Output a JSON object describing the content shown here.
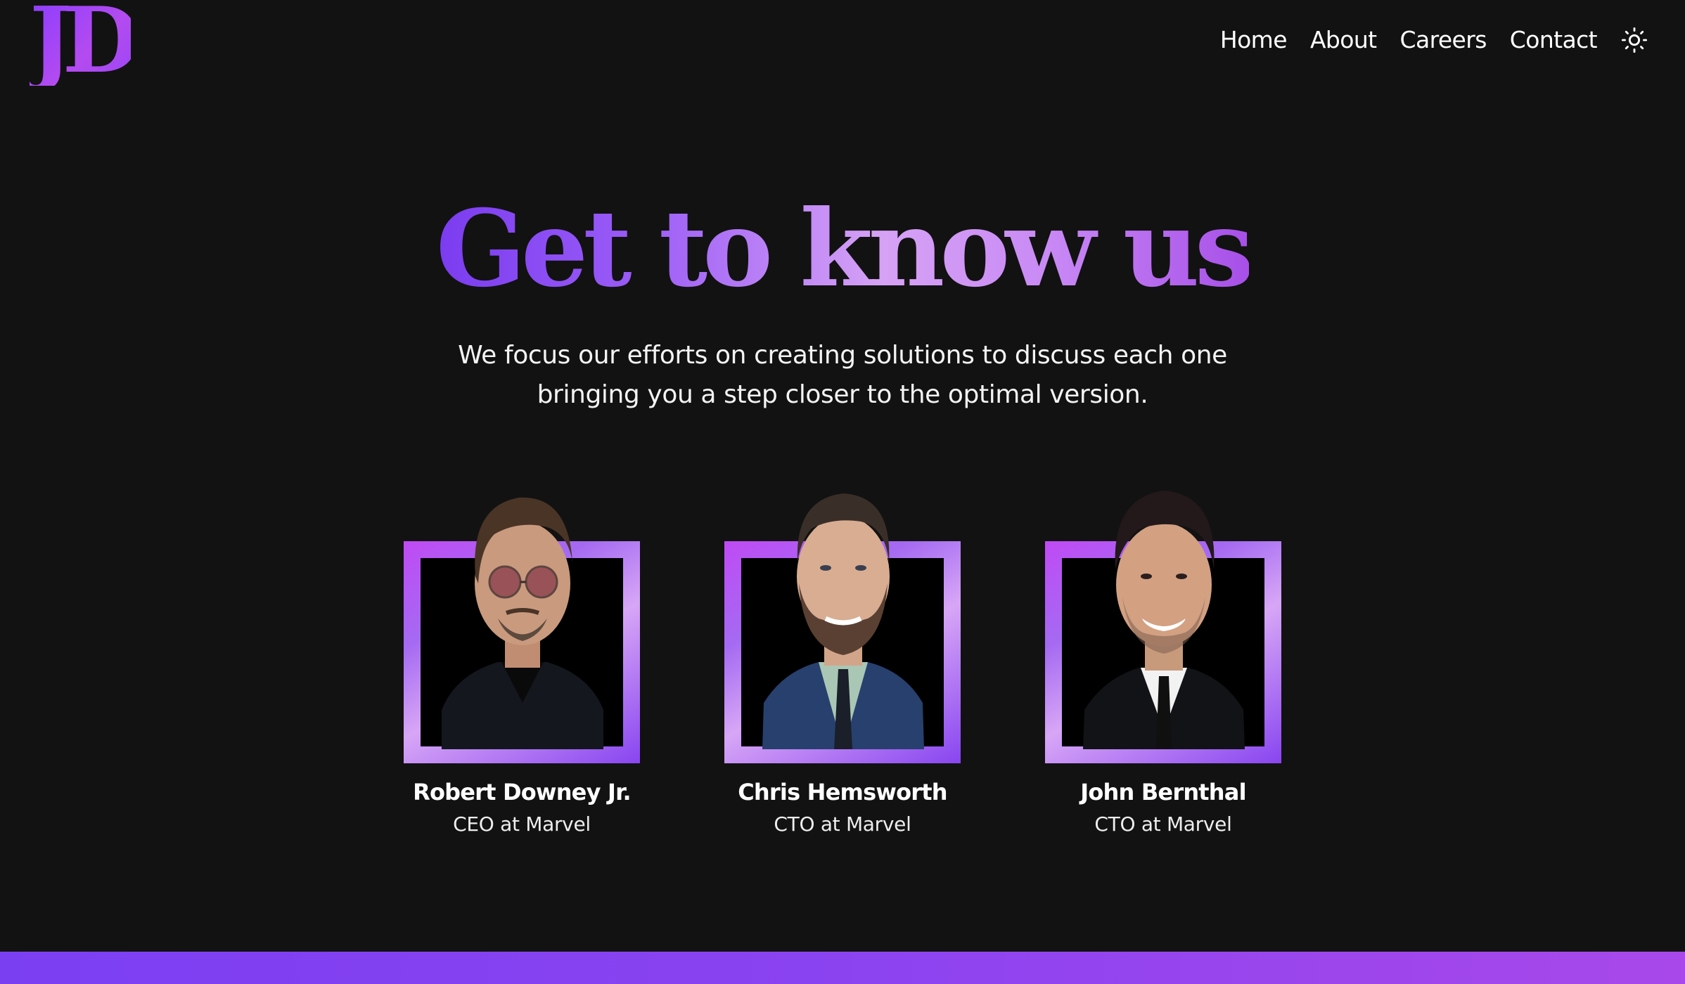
{
  "logo": {
    "text": "JD"
  },
  "nav": {
    "items": [
      {
        "label": "Home"
      },
      {
        "label": "About"
      },
      {
        "label": "Careers"
      },
      {
        "label": "Contact"
      }
    ],
    "theme_toggle_icon": "sun-icon"
  },
  "hero": {
    "title": "Get to know us",
    "subtitle_line1": "We focus our efforts on creating solutions to discuss each one",
    "subtitle_line2": "bringing you a step closer to the optimal version."
  },
  "team": {
    "members": [
      {
        "name": "Robert Downey Jr.",
        "role": "CEO at Marvel",
        "photo_icon": "person-photo"
      },
      {
        "name": "Chris Hemsworth",
        "role": "CTO at Marvel",
        "photo_icon": "person-photo"
      },
      {
        "name": "John Bernthal",
        "role": "CTO at Marvel",
        "photo_icon": "person-photo"
      }
    ]
  },
  "colors": {
    "background": "#121212",
    "accent_purple": "#7b3ff2",
    "accent_violet": "#b44bf0",
    "accent_light": "#d6a2f5",
    "text": "#ffffff"
  }
}
